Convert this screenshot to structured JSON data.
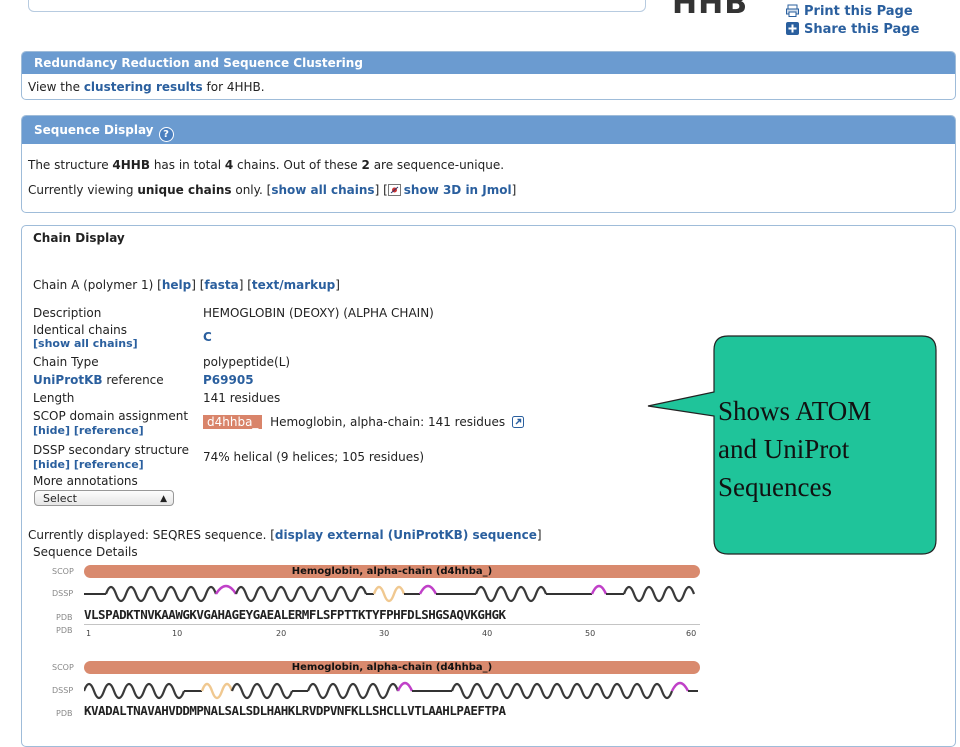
{
  "header": {
    "logo": "HHB",
    "print_label": "Print this Page",
    "share_label": "Share this Page"
  },
  "redundancy": {
    "title": "Redundancy Reduction and Sequence Clustering",
    "text_pre": "View the ",
    "link": "clustering results",
    "text_post": " for 4HHB."
  },
  "sequence_display": {
    "title": "Sequence Display",
    "help_glyph": "?",
    "line1_a": "The structure ",
    "line1_b": "4HHB",
    "line1_c": " has in total ",
    "line1_d": "4",
    "line1_e": " chains. Out of these ",
    "line1_f": "2",
    "line1_g": " are sequence-unique.",
    "line2_a": "Currently viewing ",
    "line2_b": "unique chains",
    "line2_c": " only. [",
    "line2_link1": "show all chains",
    "line2_d": "] [",
    "line2_link2": "show 3D in Jmol",
    "line2_e": "]"
  },
  "chain_display": {
    "title": "Chain Display",
    "chain_line_a": "Chain A   (polymer 1) [",
    "chain_help": "help",
    "chain_b": "] [",
    "chain_fasta": "fasta",
    "chain_c": "]  [",
    "chain_text": "text/markup",
    "chain_d": "]",
    "rows": {
      "description_label": "Description",
      "description_value": "HEMOGLOBIN (DEOXY) (ALPHA CHAIN)",
      "identical_label": "Identical chains",
      "identical_link": "[show all chains]",
      "identical_value": "C",
      "type_label": "Chain Type",
      "type_value": "polypeptide(L)",
      "uniprot_label_link": "UniProtKB",
      "uniprot_label_rest": " reference",
      "uniprot_value": "P69905",
      "length_label": "Length",
      "length_value": "141 residues",
      "scop_label": "SCOP domain assignment",
      "scop_links": "[hide] [reference]",
      "scop_badge": "d4hhba_",
      "scop_value": "Hemoglobin, alpha-chain: 141 residues",
      "dssp_label": "DSSP secondary structure",
      "dssp_links": "[hide] [reference]",
      "dssp_value": "74% helical (9 helices; 105 residues)",
      "more_label": "More annotations",
      "select_value": "Select"
    },
    "displayed_a": "Currently displayed: SEQRES sequence. [",
    "displayed_link": "display external (UniProtKB) sequence",
    "displayed_b": "]",
    "seq_details": "Sequence Details",
    "track_scop": "SCOP",
    "track_dssp": "DSSP",
    "track_pdb": "PDB",
    "scop_bar_label": "Hemoglobin, alpha-chain (d4hhba_)",
    "seq1": "VLSPADKTNVKAAWGKVGAHAGEYGAEALERMFLSFPTTKTYFPHFDLSHGSAQVKGHGK",
    "seq2": "KVADALTNAVAHVDDMPNALSALSDLHAHKLRVDPVNFKLLSHCLLVTLAAHLPAEFTPA",
    "ticks": [
      "1",
      "10",
      "20",
      "30",
      "40",
      "50",
      "60"
    ]
  },
  "callout": {
    "line1": "Shows ATOM",
    "line2": "and UniProt",
    "line3": "Sequences",
    "fill": "#1fc49a"
  }
}
